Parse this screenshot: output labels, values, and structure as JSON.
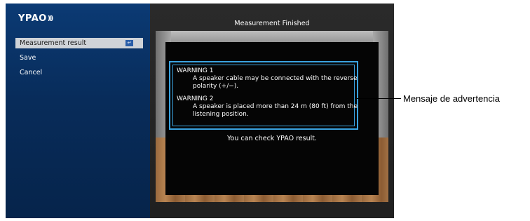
{
  "app": {
    "logo": "YPAO",
    "logo_icon": "sound-waves-icon"
  },
  "menu": {
    "items": [
      {
        "label": "Measurement result",
        "selected": true
      },
      {
        "label": "Save",
        "selected": false
      },
      {
        "label": "Cancel",
        "selected": false
      }
    ],
    "selected_icon": "enter-arrow-icon"
  },
  "main": {
    "title": "Measurement Finished",
    "warnings": [
      {
        "title": "WARNING 1",
        "message": "A speaker cable may be connected with the reverse polarity (+/−)."
      },
      {
        "title": "WARNING 2",
        "message": "A speaker is placed more than 24 m (80 ft) from the listening position."
      }
    ],
    "footer": "You can check YPAO result."
  },
  "annotation": {
    "label": "Mensaje de advertencia"
  },
  "colors": {
    "accent": "#3aa3e0",
    "sidebar": "#0b3a74",
    "selected_bg": "#cfd3d8"
  }
}
